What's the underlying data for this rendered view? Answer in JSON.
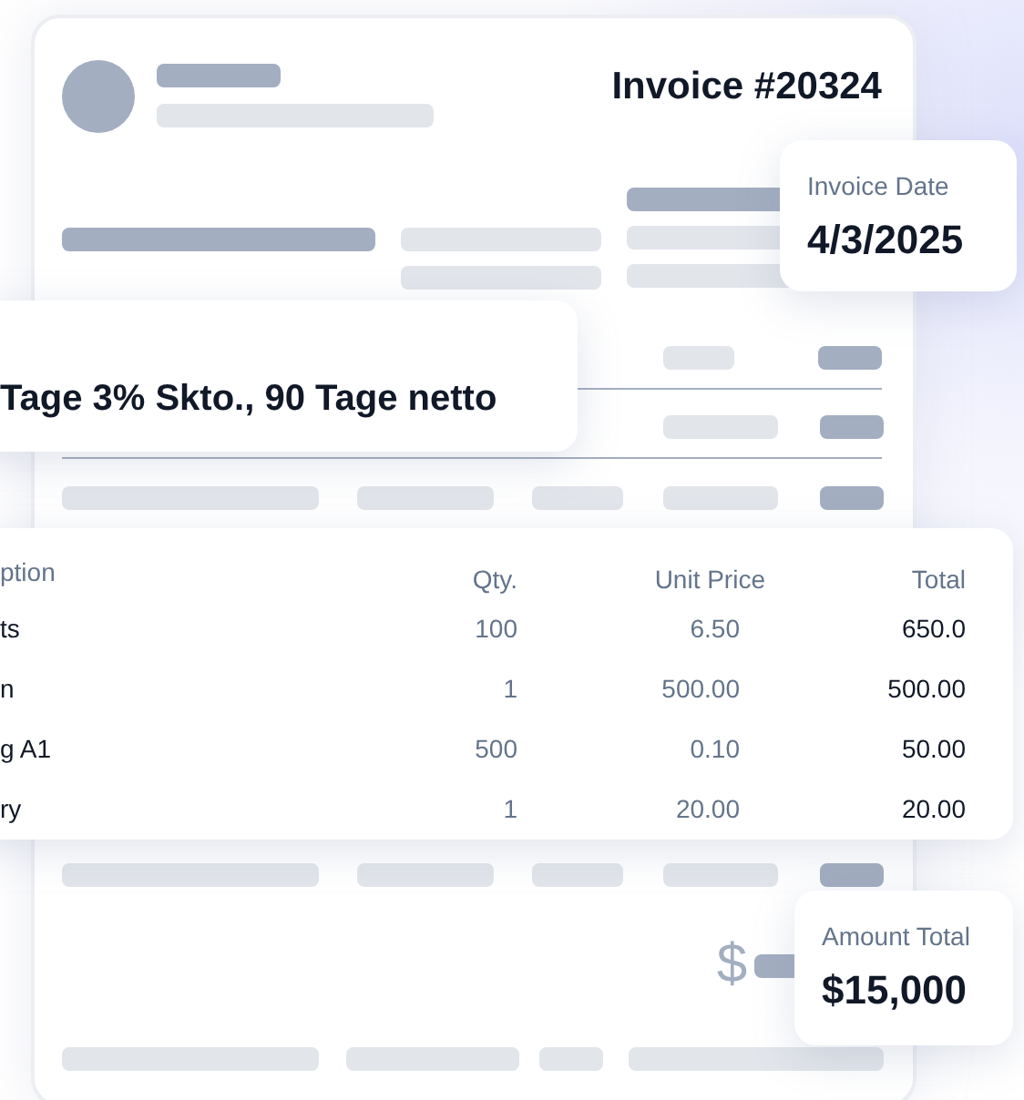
{
  "invoice": {
    "title": "Invoice #20324",
    "currency_symbol": "$"
  },
  "invoice_date": {
    "label": "Invoice Date",
    "value": "4/3/2025"
  },
  "payment_terms": {
    "text": "Tage 3% Skto., 90 Tage netto"
  },
  "line_items": {
    "columns": [
      "ption",
      "Qty.",
      "Unit Price",
      "Total"
    ],
    "rows": [
      [
        "ts",
        "100",
        "6.50",
        "650.0"
      ],
      [
        "n",
        "1",
        "500.00",
        "500.00"
      ],
      [
        "g A1",
        "500",
        "0.10",
        "50.00"
      ],
      [
        "ry",
        "1",
        "20.00",
        "20.00"
      ]
    ]
  },
  "amount_total": {
    "label": "Amount Total",
    "value": "$15,000"
  }
}
